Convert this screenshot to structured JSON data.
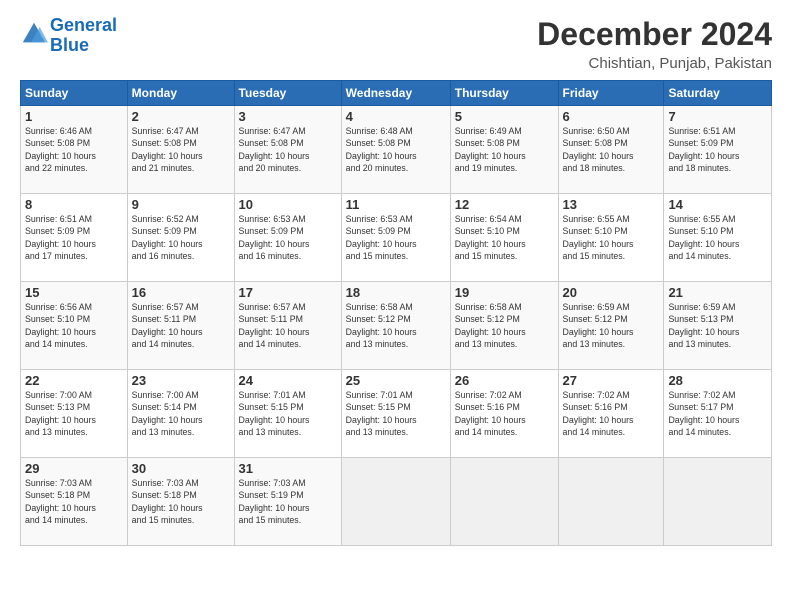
{
  "logo": {
    "line1": "General",
    "line2": "Blue"
  },
  "title": "December 2024",
  "subtitle": "Chishtian, Punjab, Pakistan",
  "days_header": [
    "Sunday",
    "Monday",
    "Tuesday",
    "Wednesday",
    "Thursday",
    "Friday",
    "Saturday"
  ],
  "weeks": [
    [
      {
        "day": "1",
        "info": "Sunrise: 6:46 AM\nSunset: 5:08 PM\nDaylight: 10 hours\nand 22 minutes."
      },
      {
        "day": "2",
        "info": "Sunrise: 6:47 AM\nSunset: 5:08 PM\nDaylight: 10 hours\nand 21 minutes."
      },
      {
        "day": "3",
        "info": "Sunrise: 6:47 AM\nSunset: 5:08 PM\nDaylight: 10 hours\nand 20 minutes."
      },
      {
        "day": "4",
        "info": "Sunrise: 6:48 AM\nSunset: 5:08 PM\nDaylight: 10 hours\nand 20 minutes."
      },
      {
        "day": "5",
        "info": "Sunrise: 6:49 AM\nSunset: 5:08 PM\nDaylight: 10 hours\nand 19 minutes."
      },
      {
        "day": "6",
        "info": "Sunrise: 6:50 AM\nSunset: 5:08 PM\nDaylight: 10 hours\nand 18 minutes."
      },
      {
        "day": "7",
        "info": "Sunrise: 6:51 AM\nSunset: 5:09 PM\nDaylight: 10 hours\nand 18 minutes."
      }
    ],
    [
      {
        "day": "8",
        "info": "Sunrise: 6:51 AM\nSunset: 5:09 PM\nDaylight: 10 hours\nand 17 minutes."
      },
      {
        "day": "9",
        "info": "Sunrise: 6:52 AM\nSunset: 5:09 PM\nDaylight: 10 hours\nand 16 minutes."
      },
      {
        "day": "10",
        "info": "Sunrise: 6:53 AM\nSunset: 5:09 PM\nDaylight: 10 hours\nand 16 minutes."
      },
      {
        "day": "11",
        "info": "Sunrise: 6:53 AM\nSunset: 5:09 PM\nDaylight: 10 hours\nand 15 minutes."
      },
      {
        "day": "12",
        "info": "Sunrise: 6:54 AM\nSunset: 5:10 PM\nDaylight: 10 hours\nand 15 minutes."
      },
      {
        "day": "13",
        "info": "Sunrise: 6:55 AM\nSunset: 5:10 PM\nDaylight: 10 hours\nand 15 minutes."
      },
      {
        "day": "14",
        "info": "Sunrise: 6:55 AM\nSunset: 5:10 PM\nDaylight: 10 hours\nand 14 minutes."
      }
    ],
    [
      {
        "day": "15",
        "info": "Sunrise: 6:56 AM\nSunset: 5:10 PM\nDaylight: 10 hours\nand 14 minutes."
      },
      {
        "day": "16",
        "info": "Sunrise: 6:57 AM\nSunset: 5:11 PM\nDaylight: 10 hours\nand 14 minutes."
      },
      {
        "day": "17",
        "info": "Sunrise: 6:57 AM\nSunset: 5:11 PM\nDaylight: 10 hours\nand 14 minutes."
      },
      {
        "day": "18",
        "info": "Sunrise: 6:58 AM\nSunset: 5:12 PM\nDaylight: 10 hours\nand 13 minutes."
      },
      {
        "day": "19",
        "info": "Sunrise: 6:58 AM\nSunset: 5:12 PM\nDaylight: 10 hours\nand 13 minutes."
      },
      {
        "day": "20",
        "info": "Sunrise: 6:59 AM\nSunset: 5:12 PM\nDaylight: 10 hours\nand 13 minutes."
      },
      {
        "day": "21",
        "info": "Sunrise: 6:59 AM\nSunset: 5:13 PM\nDaylight: 10 hours\nand 13 minutes."
      }
    ],
    [
      {
        "day": "22",
        "info": "Sunrise: 7:00 AM\nSunset: 5:13 PM\nDaylight: 10 hours\nand 13 minutes."
      },
      {
        "day": "23",
        "info": "Sunrise: 7:00 AM\nSunset: 5:14 PM\nDaylight: 10 hours\nand 13 minutes."
      },
      {
        "day": "24",
        "info": "Sunrise: 7:01 AM\nSunset: 5:15 PM\nDaylight: 10 hours\nand 13 minutes."
      },
      {
        "day": "25",
        "info": "Sunrise: 7:01 AM\nSunset: 5:15 PM\nDaylight: 10 hours\nand 13 minutes."
      },
      {
        "day": "26",
        "info": "Sunrise: 7:02 AM\nSunset: 5:16 PM\nDaylight: 10 hours\nand 14 minutes."
      },
      {
        "day": "27",
        "info": "Sunrise: 7:02 AM\nSunset: 5:16 PM\nDaylight: 10 hours\nand 14 minutes."
      },
      {
        "day": "28",
        "info": "Sunrise: 7:02 AM\nSunset: 5:17 PM\nDaylight: 10 hours\nand 14 minutes."
      }
    ],
    [
      {
        "day": "29",
        "info": "Sunrise: 7:03 AM\nSunset: 5:18 PM\nDaylight: 10 hours\nand 14 minutes."
      },
      {
        "day": "30",
        "info": "Sunrise: 7:03 AM\nSunset: 5:18 PM\nDaylight: 10 hours\nand 15 minutes."
      },
      {
        "day": "31",
        "info": "Sunrise: 7:03 AM\nSunset: 5:19 PM\nDaylight: 10 hours\nand 15 minutes."
      },
      null,
      null,
      null,
      null
    ]
  ]
}
